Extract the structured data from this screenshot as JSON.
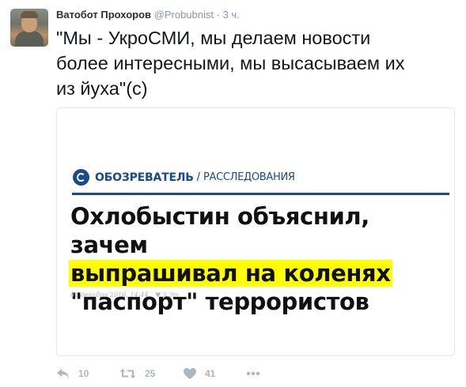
{
  "author": {
    "name": "Ватобот Прохоров",
    "handle": "@Probubnist",
    "separator": "·",
    "time": "3 ч."
  },
  "tweet": {
    "text": "\"Мы - УкроСМИ, мы делаем новости\nболее интересными, мы высасываем их\nиз йуха\"(с)"
  },
  "card": {
    "outlet": "ОБОЗРЕВАТЕЛЬ",
    "slash": "/",
    "section": "РАССЛЕДОВАНИЯ",
    "headline_line1": "Охлобыстин объяснил, зачем",
    "headline_line2": "выпрашивал на коленях",
    "headline_line3": "\"паспорт\" террористов",
    "date": "01 декабря 2016, 14:44",
    "views": "5.3т",
    "accent_color": "#1a4a8a",
    "highlight_color": "#ffff00"
  },
  "actions": {
    "reply_icon": "reply-icon",
    "retweet_icon": "retweet-icon",
    "like_icon": "heart-icon",
    "more_icon": "more-dots-icon",
    "reply_count": "10",
    "retweet_count": "25",
    "like_count": "41"
  }
}
